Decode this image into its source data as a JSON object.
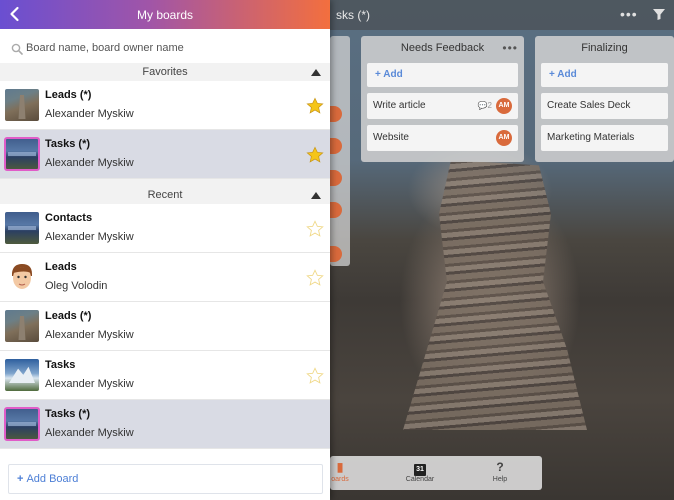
{
  "drawer": {
    "title": "My boards",
    "search_placeholder": "Board name, board owner name",
    "favorites_label": "Favorites",
    "recent_label": "Recent",
    "add_board_label": "Add Board",
    "favorites": [
      {
        "title": "Leads (*)",
        "owner": "Alexander Myskiw",
        "icon": "cairn-photo",
        "starred": true,
        "selected": false
      },
      {
        "title": "Tasks (*)",
        "owner": "Alexander Myskiw",
        "icon": "lake-photo",
        "starred": true,
        "selected": true
      }
    ],
    "recent": [
      {
        "title": "Contacts",
        "owner": "Alexander Myskiw",
        "icon": "lake-photo",
        "starred": false,
        "selected": false
      },
      {
        "title": "Leads",
        "owner": "Oleg Volodin",
        "icon": "avatar-face",
        "starred": false,
        "selected": false
      },
      {
        "title": "Leads (*)",
        "owner": "Alexander Myskiw",
        "icon": "cairn-photo",
        "starred": false,
        "selected": false
      },
      {
        "title": "Tasks",
        "owner": "Alexander Myskiw",
        "icon": "mountain-photo",
        "starred": false,
        "selected": false
      },
      {
        "title": "Tasks (*)",
        "owner": "Alexander Myskiw",
        "icon": "lake-photo",
        "starred": false,
        "selected": true
      }
    ]
  },
  "board": {
    "title_fragment": "sks (*)",
    "columns": [
      {
        "title": "Needs Feedback",
        "add_label": "Add",
        "cards": [
          {
            "text": "Write article",
            "comments": "2",
            "avatar": "AM"
          },
          {
            "text": "Website",
            "comments": "",
            "avatar": "AM"
          }
        ]
      },
      {
        "title": "Finalizing",
        "add_label": "Add",
        "cards": [
          {
            "text": "Create Sales Deck"
          },
          {
            "text": "Marketing Materials"
          }
        ]
      }
    ],
    "tabs": [
      {
        "label": "oards",
        "icon": "boards-icon"
      },
      {
        "label": "Calendar",
        "icon": "calendar-icon",
        "badge": "31"
      },
      {
        "label": "Help",
        "icon": "help-icon",
        "glyph": "?"
      }
    ]
  },
  "colors": {
    "header_gradient_start": "#6a4fd1",
    "header_gradient_end": "#f36f3e",
    "selected_row": "#d9dbe4",
    "star_filled": "#f5c518",
    "link_blue": "#4d7fd6",
    "avatar_orange": "#d96a3c"
  }
}
